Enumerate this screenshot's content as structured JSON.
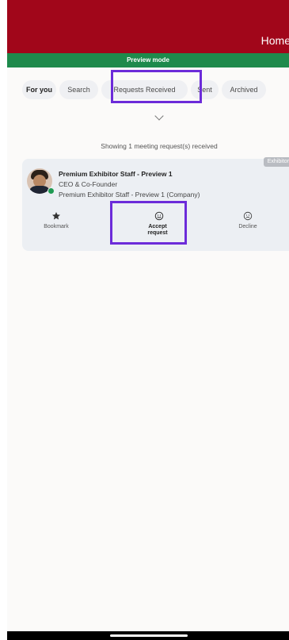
{
  "header": {
    "title": "Home"
  },
  "preview_bar": {
    "label": "Preview mode"
  },
  "tabs": [
    {
      "label": "For you"
    },
    {
      "label": "Search"
    },
    {
      "label": "Requests Received"
    },
    {
      "label": "Sent"
    },
    {
      "label": "Archived"
    }
  ],
  "showing_text": "Showing 1 meeting request(s) received",
  "request_card": {
    "badge": "Exhibitor",
    "name": "Premium Exhibitor Staff - Preview 1",
    "role": "CEO & Co-Founder",
    "company": "Premium Exhibitor Staff - Preview 1 (Company)",
    "status": "online",
    "actions": [
      {
        "label": "Bookmark",
        "icon": "star-icon"
      },
      {
        "label": "Accept request",
        "icon": "smile-icon"
      },
      {
        "label": "Decline",
        "icon": "frown-icon"
      }
    ]
  },
  "colors": {
    "header": "#a1061a",
    "preview_bar": "#1e8a4c",
    "highlight": "#6c2bd9",
    "online": "#1e9a52"
  }
}
